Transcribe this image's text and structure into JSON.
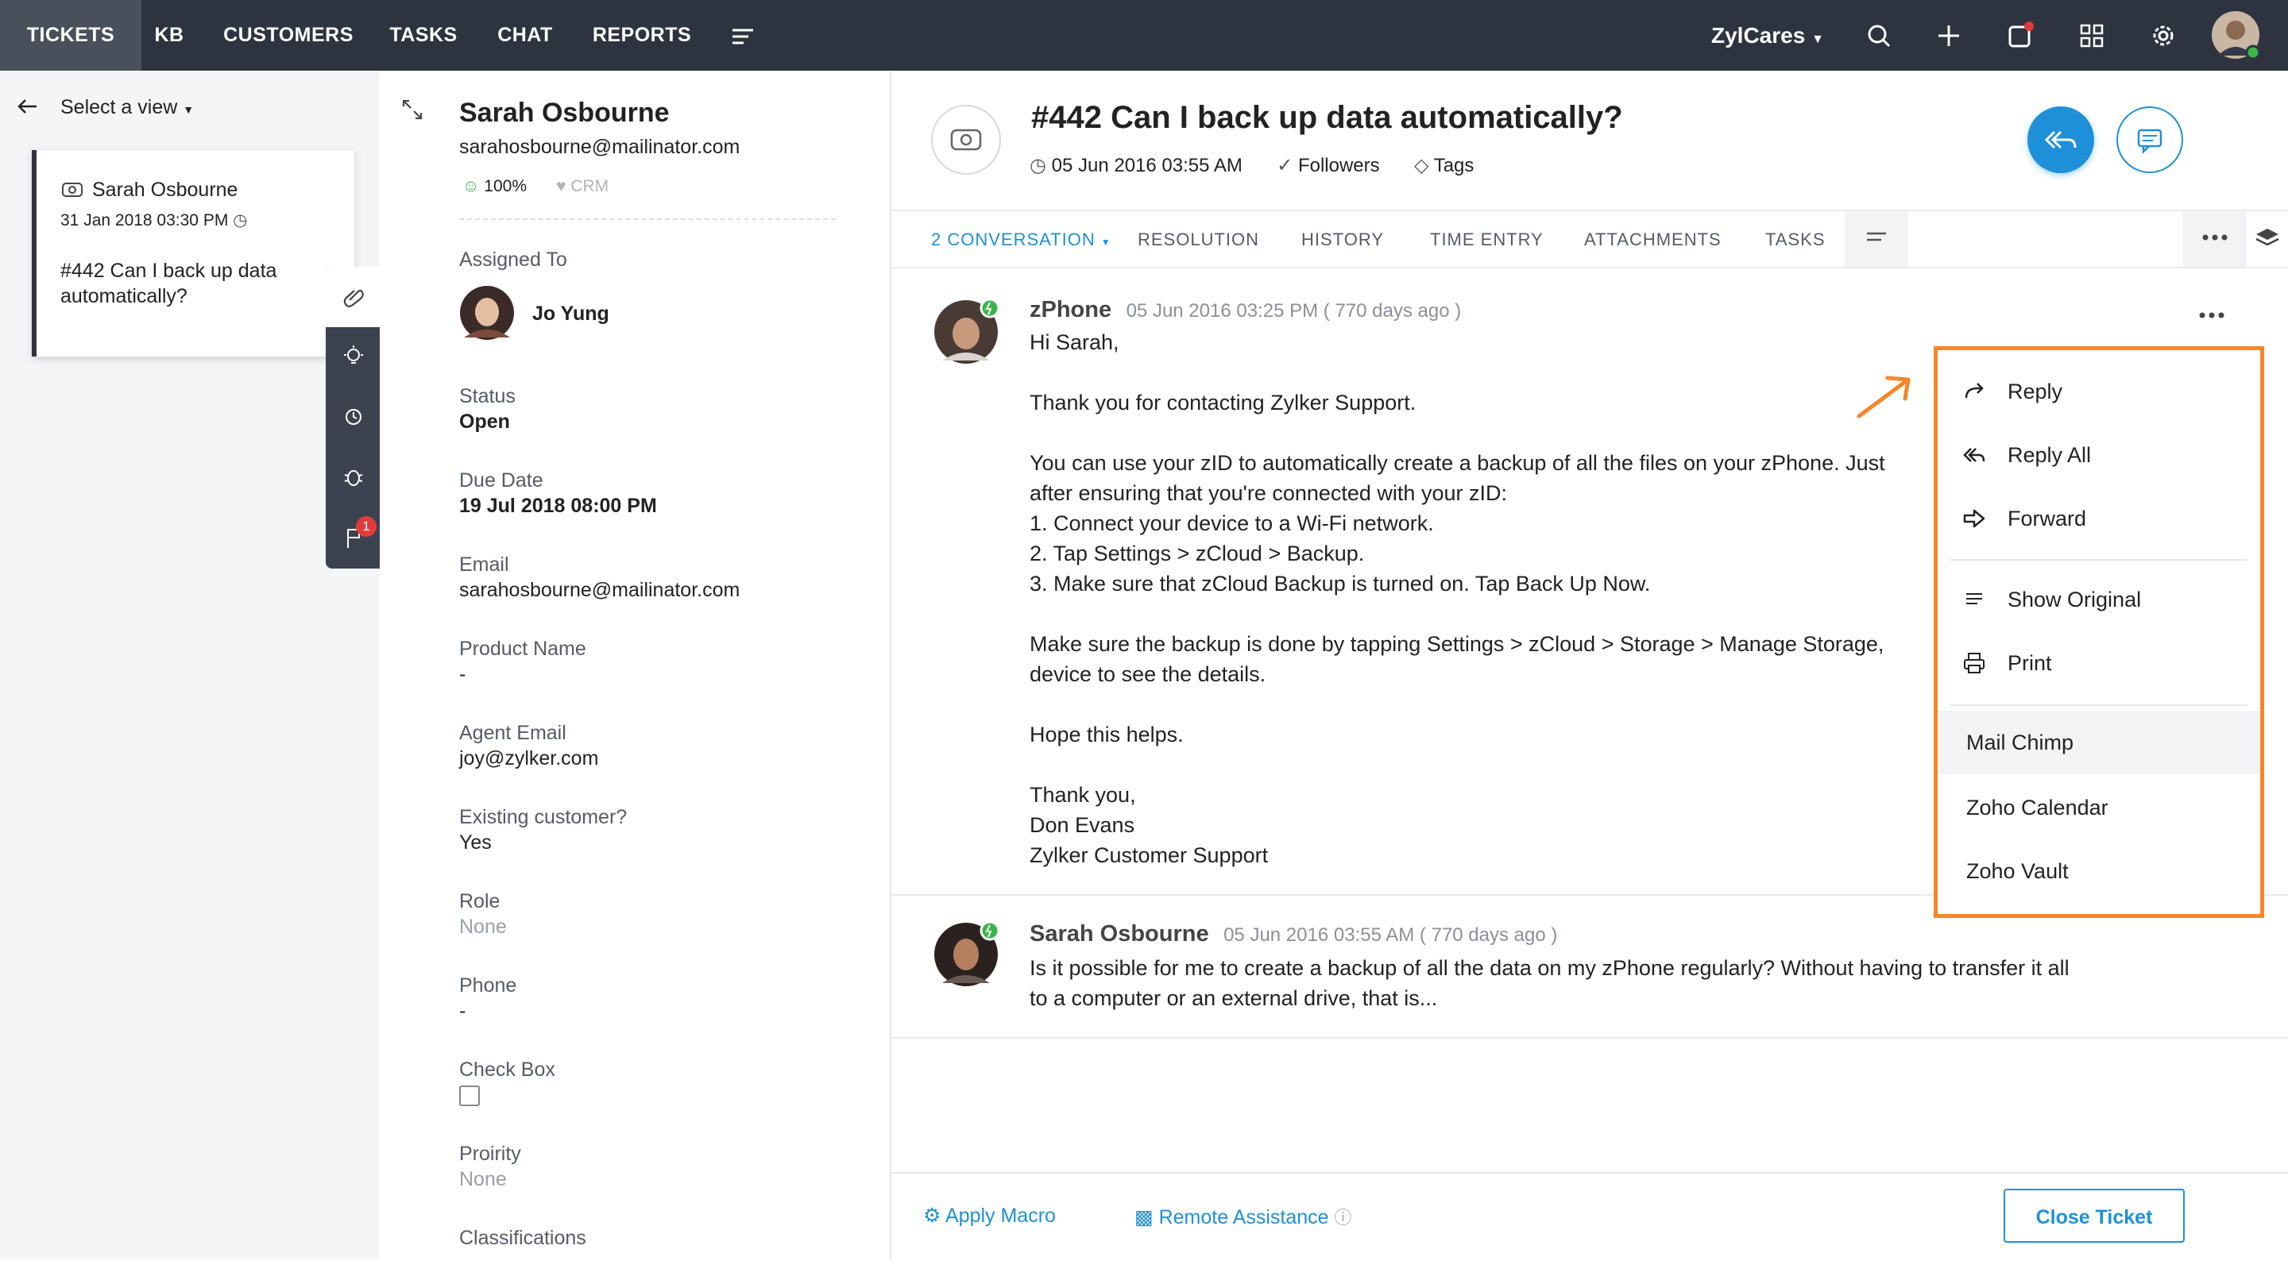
{
  "colors": {
    "nav_bg": "#2e3340",
    "accent": "#1e90d9",
    "highlight": "#f5862a",
    "online": "#3bb54a",
    "badge": "#e23b3b"
  },
  "topnav": {
    "items": [
      "TICKETS",
      "KB",
      "CUSTOMERS",
      "TASKS",
      "CHAT",
      "REPORTS"
    ],
    "brand": "ZylCares",
    "icons": [
      "search-icon",
      "plus-icon",
      "notification-icon",
      "apps-icon",
      "settings-icon",
      "avatar"
    ]
  },
  "listpane": {
    "view_label": "Select a view",
    "card": {
      "name": "Sarah Osbourne",
      "date": "31 Jan 2018 03:30 PM",
      "subject": "#442  Can I back up data automatically?"
    },
    "strip_badge": "1"
  },
  "contact": {
    "name": "Sarah Osbourne",
    "email": "sarahosbourne@mailinator.com",
    "score": "100%",
    "crm": "CRM",
    "assigned_label": "Assigned To",
    "assignee": "Jo Yung",
    "fields": [
      {
        "label": "Status",
        "value": "Open"
      },
      {
        "label": "Due Date",
        "value": "19 Jul 2018 08:00 PM"
      },
      {
        "label": "Email",
        "value": "sarahosbourne@mailinator.com"
      },
      {
        "label": "Product Name",
        "value": "-"
      },
      {
        "label": "Agent Email",
        "value": "joy@zylker.com"
      },
      {
        "label": "Existing customer?",
        "value": "Yes"
      },
      {
        "label": "Role",
        "value": "None"
      },
      {
        "label": "Phone",
        "value": "-"
      },
      {
        "label": "Check Box",
        "value": ""
      },
      {
        "label": "Proirity",
        "value": "None"
      },
      {
        "label": "Classifications",
        "value": ""
      }
    ]
  },
  "ticket": {
    "title": "#442 Can I back up data automatically?",
    "date": "05 Jun 2016 03:55 AM",
    "followers": "Followers",
    "tags": "Tags",
    "tabs": [
      "2 CONVERSATION",
      "RESOLUTION",
      "HISTORY",
      "TIME ENTRY",
      "ATTACHMENTS",
      "TASKS"
    ]
  },
  "messages": [
    {
      "sender": "zPhone",
      "time": "05 Jun 2016 03:25 PM ( 770 days ago )",
      "lines": [
        "Hi Sarah,",
        "",
        "Thank you for contacting Zylker Support.",
        "",
        "You can use your zID to automatically create a backup of all the files on your zPhone. Just",
        "after ensuring that you're connected with your zID:",
        "1. Connect your device to a Wi-Fi network.",
        "2. Tap Settings > zCloud > Backup.",
        "3. Make sure that zCloud Backup is turned on. Tap Back Up Now.",
        "",
        "Make sure the backup is done by tapping Settings > zCloud > Storage > Manage Storage,",
        "device to see the details.",
        "",
        "Hope this helps.",
        "",
        "Thank you,",
        "Don Evans",
        "Zylker Customer Support"
      ]
    },
    {
      "sender": "Sarah Osbourne",
      "time": "05 Jun 2016 03:55 AM ( 770 days ago )",
      "lines": [
        "Is it possible for me to create a backup of all the data on my zPhone regularly? Without having to transfer it all",
        "to a computer or an external drive, that is..."
      ]
    }
  ],
  "menu": {
    "items": [
      "Reply",
      "Reply All",
      "Forward",
      "Show Original",
      "Print",
      "Mail Chimp",
      "Zoho Calendar",
      "Zoho Vault"
    ]
  },
  "bottom": {
    "apply_macro": "Apply Macro",
    "remote_assistance": "Remote Assistance",
    "close_ticket": "Close Ticket"
  }
}
